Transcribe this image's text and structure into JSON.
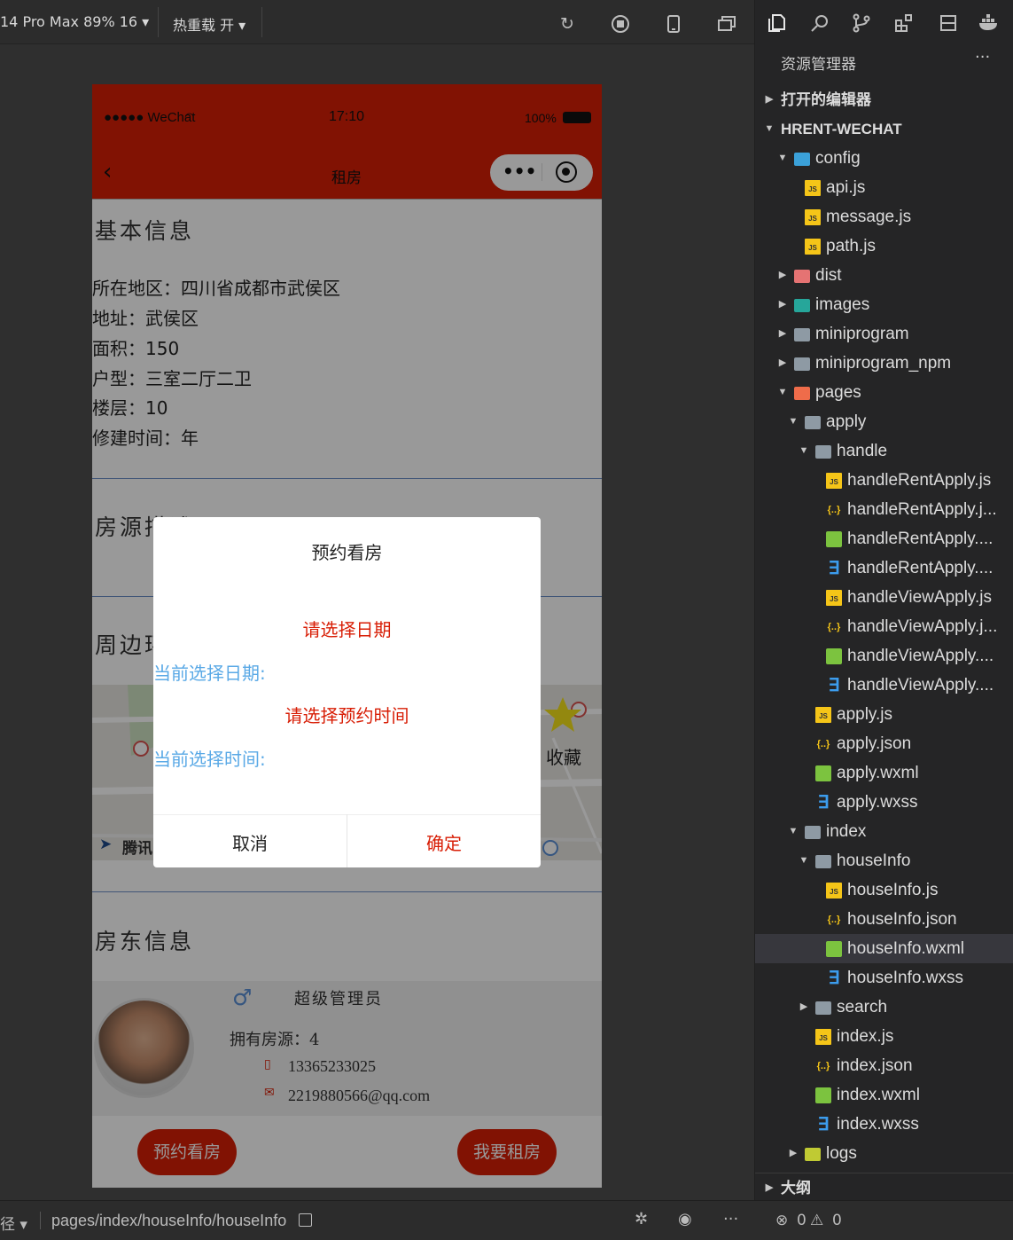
{
  "toolbar": {
    "device_label": "14 Pro Max 89% 16 ▾",
    "hotreload_label": "热重载 开 ▾"
  },
  "phone": {
    "status": {
      "carrier": "●●●●● WeChat",
      "time": "17:10",
      "battery": "100%"
    },
    "nav_title": "租房",
    "sections": {
      "basic": "基本信息",
      "desc": "房源描述",
      "around": "周边环境",
      "landlord": "房东信息"
    },
    "info": [
      "所在地区：四川省成都市武侯区",
      "地址：武侯区",
      "面积：150",
      "户型：三室二厅二卫",
      "楼层：10",
      "修建时间：年"
    ],
    "map": {
      "favorite": "收藏",
      "brand": "腾讯"
    },
    "landlord": {
      "name": "超级管理员",
      "count_label": "拥有房源：4",
      "phone": "13365233025",
      "email": "2219880566@qq.com"
    },
    "buttons": {
      "book": "预约看房",
      "rent": "我要租房"
    }
  },
  "modal": {
    "title": "预约看房",
    "choose_date": "请选择日期",
    "current_date": "当前选择日期:",
    "choose_time": "请选择预约时间",
    "current_time": "当前选择时间:",
    "cancel": "取消",
    "confirm": "确定"
  },
  "explorer": {
    "title": "资源管理器",
    "more": "···",
    "open_editors": "打开的编辑器",
    "project": "HRENT-WECHAT",
    "tree": [
      "config",
      "api.js",
      "message.js",
      "path.js",
      "dist",
      "images",
      "miniprogram",
      "miniprogram_npm",
      "pages",
      "apply",
      "handle",
      "handleRentApply.js",
      "handleRentApply.j...",
      "handleRentApply....",
      "handleRentApply....",
      "handleViewApply.js",
      "handleViewApply.j...",
      "handleViewApply....",
      "handleViewApply....",
      "apply.js",
      "apply.json",
      "apply.wxml",
      "apply.wxss",
      "index",
      "houseInfo",
      "houseInfo.js",
      "houseInfo.json",
      "houseInfo.wxml",
      "houseInfo.wxss",
      "search",
      "index.js",
      "index.json",
      "index.wxml",
      "index.wxss",
      "logs"
    ],
    "outline": "大纲"
  },
  "footer": {
    "path_prefix": "径 ▾",
    "path": "pages/index/houseInfo/houseInfo",
    "errors": "0",
    "warnings": "0"
  },
  "colors": {
    "brand_red": "#d81e06",
    "link_blue": "#5aa9e6",
    "sidebar_bg": "#252526",
    "selected_row": "#37373d"
  }
}
